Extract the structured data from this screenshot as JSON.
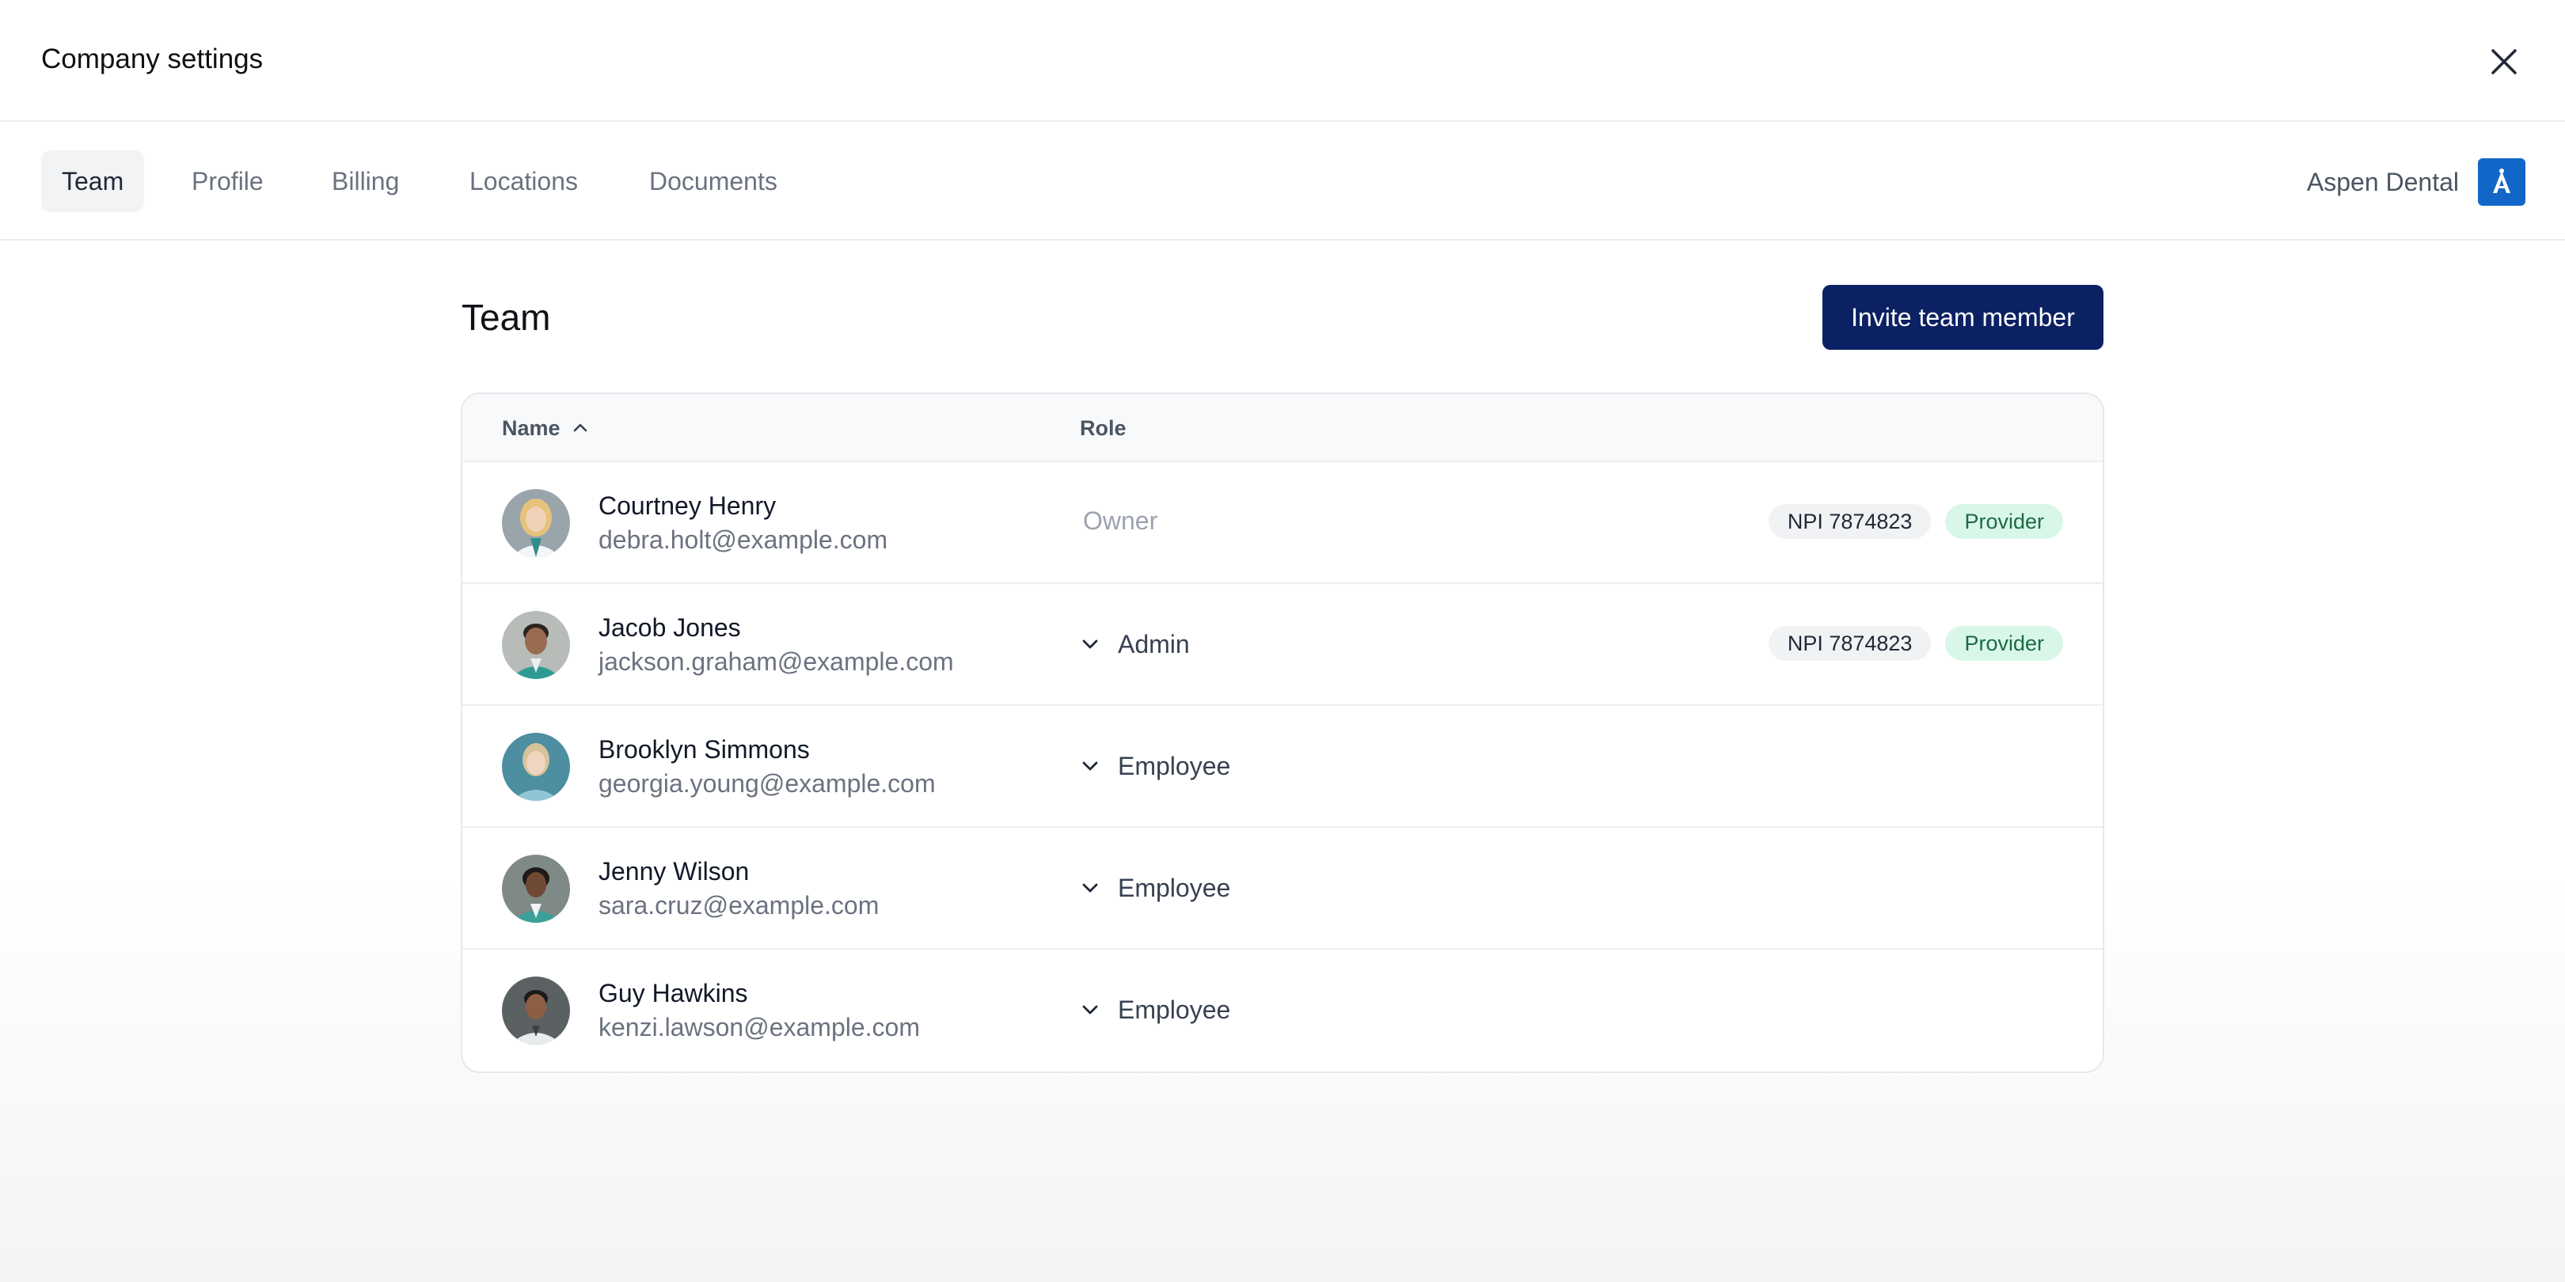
{
  "header": {
    "title": "Company settings",
    "close_icon": "close-icon"
  },
  "tabs": [
    {
      "label": "Team",
      "active": true
    },
    {
      "label": "Profile",
      "active": false
    },
    {
      "label": "Billing",
      "active": false
    },
    {
      "label": "Locations",
      "active": false
    },
    {
      "label": "Documents",
      "active": false
    }
  ],
  "company": {
    "name": "Aspen Dental",
    "logo_color": "#1266c8"
  },
  "page": {
    "title": "Team",
    "invite_label": "Invite team member",
    "invite_color": "#0b2163"
  },
  "table": {
    "columns": {
      "name": "Name",
      "role": "Role",
      "sort": "ascending"
    },
    "rows": [
      {
        "name": "Courtney Henry",
        "email": "debra.holt@example.com",
        "role": "Owner",
        "role_editable": false,
        "npi": "NPI 7874823",
        "tag": "Provider"
      },
      {
        "name": "Jacob Jones",
        "email": "jackson.graham@example.com",
        "role": "Admin",
        "role_editable": true,
        "npi": "NPI 7874823",
        "tag": "Provider"
      },
      {
        "name": "Brooklyn Simmons",
        "email": "georgia.young@example.com",
        "role": "Employee",
        "role_editable": true
      },
      {
        "name": "Jenny Wilson",
        "email": "sara.cruz@example.com",
        "role": "Employee",
        "role_editable": true
      },
      {
        "name": "Guy Hawkins",
        "email": "kenzi.lawson@example.com",
        "role": "Employee",
        "role_editable": true
      }
    ]
  }
}
